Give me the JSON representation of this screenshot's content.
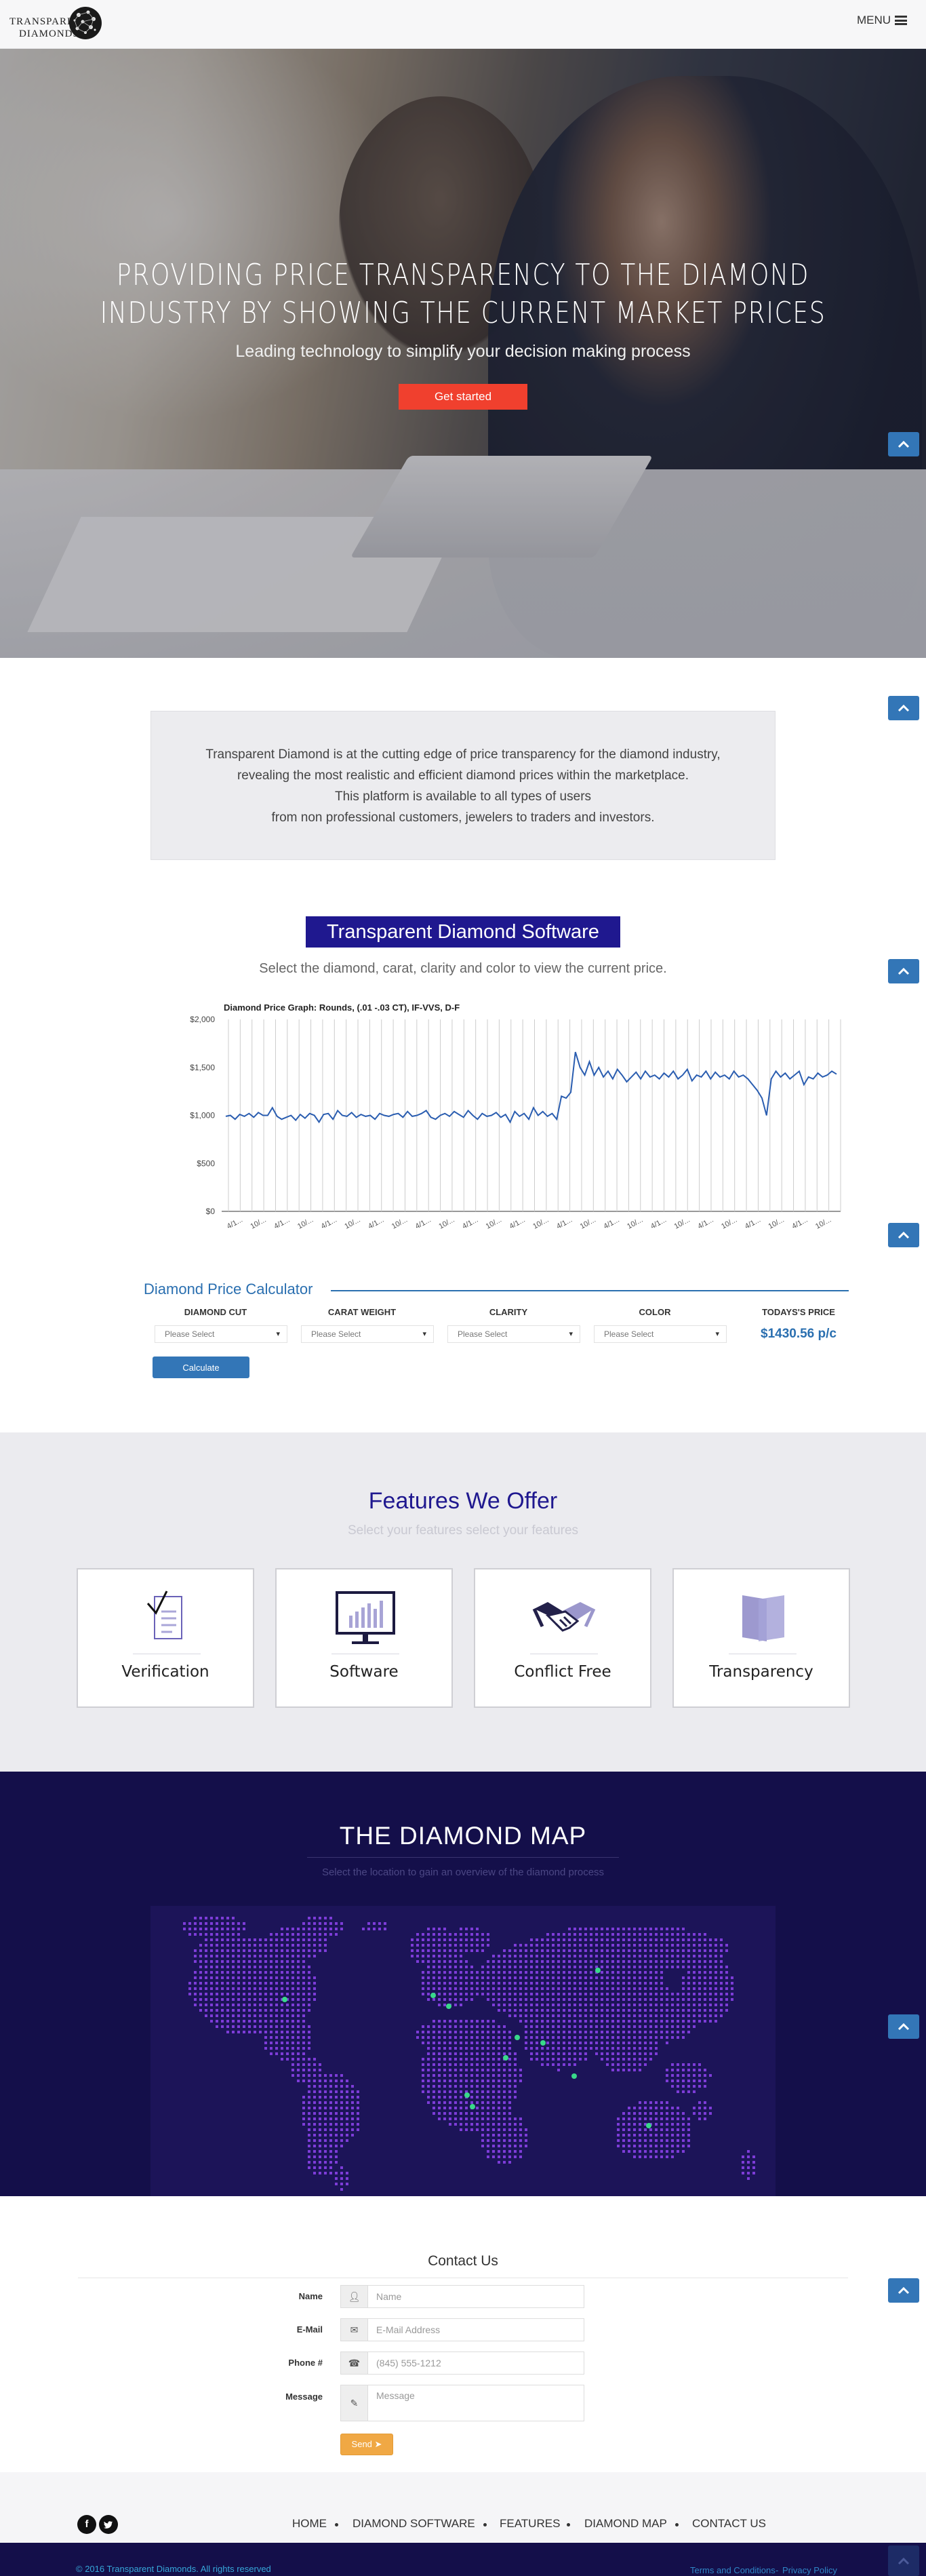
{
  "header": {
    "logo_line1": "TRANSPARENT",
    "logo_line2": "DIAMONDS",
    "menu_label": "MENU"
  },
  "hero": {
    "title_line1": "Providing price transparency to the diamond",
    "title_line2": "industry by showing the current market prices",
    "subtitle": "Leading technology to simplify your decision making process",
    "cta": "Get started"
  },
  "intro": {
    "lines": [
      "Transparent Diamond is at the cutting edge of price transparency for the diamond industry,",
      "revealing the most realistic and efficient diamond prices within the marketplace.",
      "This platform is available to all types of users",
      "from non professional customers, jewelers to traders and investors."
    ]
  },
  "software": {
    "title": "Transparent Diamond Software",
    "subtitle": "Select the diamond, carat, clarity and color to view the current price."
  },
  "chart_data": {
    "type": "line",
    "title": "Diamond Price Graph: Rounds, (.01 -.03 CT), IF-VVS, D-F",
    "ylim": [
      0,
      2000
    ],
    "yticks": [
      "$0",
      "$500",
      "$1,000",
      "$1,500",
      "$2,000"
    ],
    "ytick_values": [
      0,
      500,
      1000,
      1500,
      2000
    ],
    "xtick_labels": [
      "4/1...",
      "10/...",
      "4/1...",
      "10/...",
      "4/1...",
      "10/...",
      "4/1...",
      "10/...",
      "4/1...",
      "10/...",
      "4/1...",
      "10/...",
      "4/1...",
      "10/...",
      "4/1...",
      "10/...",
      "4/1...",
      "10/...",
      "4/1...",
      "10/...",
      "4/1...",
      "10/...",
      "4/1...",
      "10/...",
      "4/1...",
      "10/..."
    ],
    "grid": "vertical",
    "color": "#2a5db0",
    "series": [
      {
        "values": [
          990,
          1000,
          960,
          1010,
          990,
          1020,
          980,
          1030,
          1000,
          1000,
          1080,
          990,
          960,
          980,
          1000,
          950,
          1010,
          970,
          1020,
          1000,
          930,
          1010,
          1020,
          960,
          1050,
          1000,
          990,
          1030,
          980,
          1010,
          990,
          1000,
          960,
          1020,
          1000,
          990,
          1010,
          1020,
          980,
          1040,
          990,
          1000,
          1020,
          1050,
          980,
          960,
          1000,
          1020,
          990,
          1040,
          1010,
          980,
          1050,
          1000,
          960,
          1020,
          990,
          1000,
          1030,
          980,
          1010,
          930,
          1040,
          990,
          1020,
          960,
          1080,
          1000,
          1040,
          990,
          1020,
          960,
          1200,
          1180,
          1240,
          1660,
          1500,
          1420,
          1560,
          1420,
          1500,
          1400,
          1460,
          1380,
          1480,
          1420,
          1350,
          1400,
          1450,
          1380,
          1460,
          1400,
          1420,
          1380,
          1440,
          1400,
          1460,
          1380,
          1420,
          1480,
          1360,
          1420,
          1400,
          1460,
          1380,
          1450,
          1400,
          1420,
          1380,
          1460,
          1400,
          1420,
          1380,
          1320,
          1260,
          1180,
          1000,
          1380,
          1460,
          1400,
          1440,
          1380,
          1420,
          1460,
          1320,
          1400,
          1380,
          1440,
          1400,
          1420,
          1460,
          1430
        ]
      }
    ]
  },
  "calculator": {
    "title": "Diamond Price Calculator",
    "columns": [
      {
        "header": "DIAMOND CUT",
        "value": "Please Select"
      },
      {
        "header": "CARAT WEIGHT",
        "value": "Please Select"
      },
      {
        "header": "CLARITY",
        "value": "Please Select"
      },
      {
        "header": "COLOR",
        "value": "Please Select"
      }
    ],
    "price_header": "TODAYS'S PRICE",
    "price": "$1430.56 p/c",
    "button": "Calculate"
  },
  "features": {
    "title": "Features We Offer",
    "subtitle": "Select your features select your features",
    "items": [
      {
        "label": "Verification",
        "icon": "checklist-icon"
      },
      {
        "label": "Software",
        "icon": "monitor-chart-icon"
      },
      {
        "label": "Conflict Free",
        "icon": "handshake-icon"
      },
      {
        "label": "Transparency",
        "icon": "transparent-panes-icon"
      }
    ]
  },
  "map": {
    "title": "THE DIAMOND MAP",
    "subtitle": "Select the location to gain an overview of the diamond process"
  },
  "contact": {
    "title": "Contact Us",
    "fields": [
      {
        "label": "Name",
        "placeholder": "Name",
        "icon": "user-icon"
      },
      {
        "label": "E-Mail",
        "placeholder": "E-Mail Address",
        "icon": "envelope-icon"
      },
      {
        "label": "Phone #",
        "placeholder": "(845) 555-1212",
        "icon": "phone-icon"
      },
      {
        "label": "Message",
        "placeholder": "Message",
        "icon": "pencil-icon"
      }
    ],
    "send": "Send"
  },
  "footer": {
    "nav": [
      "HOME",
      "DIAMOND SOFTWARE",
      "FEATURES",
      "DIAMOND MAP",
      "CONTACT US"
    ],
    "copyright": "© 2016 Transparent Diamonds. All rights reserved",
    "terms": "Terms and Conditions",
    "privacy": "Privacy Policy"
  },
  "colors": {
    "accent_blue": "#3376b7",
    "brand_navy": "#1f188f",
    "map_bg": "#140f4a",
    "cta_red": "#f0402e",
    "send_orange": "#f0a844",
    "map_dot": "#7d3cd8",
    "map_marker": "#39d98a"
  }
}
